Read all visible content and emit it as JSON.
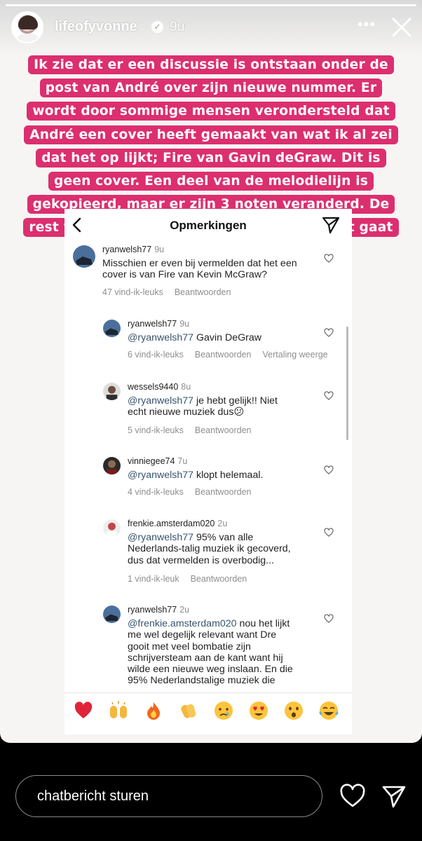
{
  "story": {
    "username": "lifeofyvonne",
    "time": "9u",
    "progress": 1.0,
    "caption": "Ik zie dat er een discussie is ontstaan onder de post van André over zijn nieuwe nummer. Er wordt door sommige mensen verondersteld dat André een cover heeft gemaakt van wat ik al zei dat het op lijkt; Fire van Gavin deGraw. Dit is geen cover. Een deel van de melodielijn is gekopieerd, maar er zijn 3 noten veranderd. De rest van het refrein lijkt er ook niet op. Het gaat dus niet om een cover.",
    "accent_color": "#dc2f6f"
  },
  "screenshot": {
    "title": "Opmerkingen",
    "comments": [
      {
        "user": "ryanwelsh77",
        "time": "9u",
        "mention": "",
        "text": "Misschien er even bij vermelden dat het een cover is van Fire van Kevin McGraw?",
        "likes": "47 vind-ik-leuks",
        "reply": "Beantwoorden",
        "translate": ""
      },
      {
        "user": "ryanwelsh77",
        "time": "9u",
        "mention": "@ryanwelsh77",
        "text": " Gavin DeGraw",
        "likes": "6 vind-ik-leuks",
        "reply": "Beantwoorden",
        "translate": "Vertaling weerge"
      },
      {
        "user": "wessels9440",
        "time": "8u",
        "mention": "@ryanwelsh77",
        "text": " je hebt gelijk!! Niet echt nieuwe muziek dus",
        "emoji": "😕",
        "likes": "5 vind-ik-leuks",
        "reply": "Beantwoorden",
        "translate": ""
      },
      {
        "user": "vinniegee74",
        "time": "7u",
        "mention": "@ryanwelsh77",
        "text": " klopt helemaal.",
        "likes": "4 vind-ik-leuks",
        "reply": "Beantwoorden",
        "translate": ""
      },
      {
        "user": "frenkie.amsterdam020",
        "time": "2u",
        "mention": "@ryanwelsh77",
        "text": " 95% van alle Nederlands-talig muziek ik gecoverd, dus dat vermelden is overbodig...",
        "likes": "1 vind-ik-leuk",
        "reply": "Beantwoorden",
        "translate": ""
      },
      {
        "user": "ryanwelsh77",
        "time": "2u",
        "mention": "@frenkie.amsterdam020",
        "text": " nou het lijkt me wel degelijk relevant want Dre gooit met veel bombatie zijn schrijversteam aan de kant want hij wilde een nieuwe weg inslaan. En die 95% Nederlandstalige muziek die",
        "likes": "",
        "reply": "",
        "translate": ""
      }
    ],
    "reactions": [
      "red-heart",
      "raising-hands",
      "fire",
      "clapping-hands",
      "crying-face",
      "heart-eyes-face",
      "surprised-face",
      "tears-of-joy-face"
    ]
  },
  "reply": {
    "placeholder": "chatbericht sturen"
  }
}
